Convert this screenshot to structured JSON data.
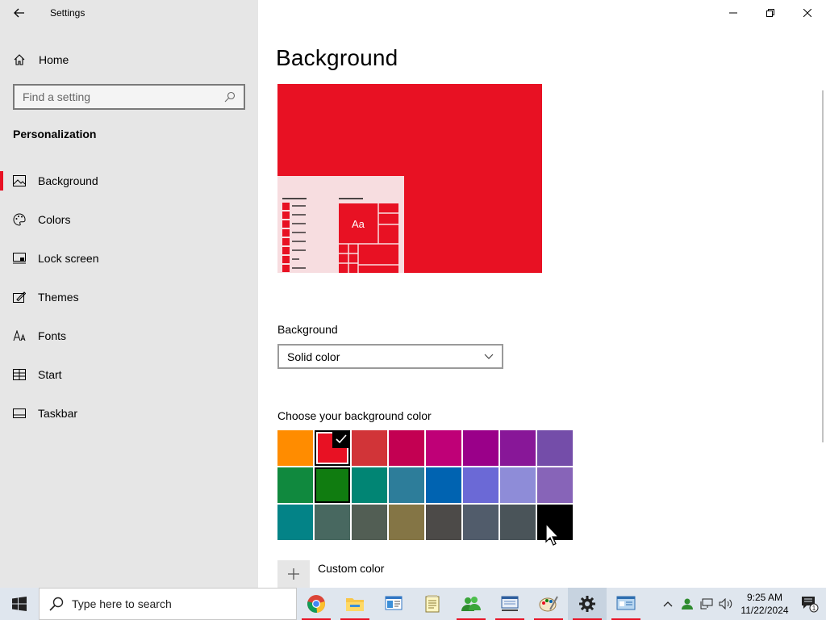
{
  "window": {
    "title": "Settings"
  },
  "sidebar": {
    "home_label": "Home",
    "search_placeholder": "Find a setting",
    "section_heading": "Personalization",
    "items": [
      {
        "label": "Background",
        "icon": "picture-icon",
        "active": true
      },
      {
        "label": "Colors",
        "icon": "palette-icon",
        "active": false
      },
      {
        "label": "Lock screen",
        "icon": "lock-screen-icon",
        "active": false
      },
      {
        "label": "Themes",
        "icon": "themes-icon",
        "active": false
      },
      {
        "label": "Fonts",
        "icon": "fonts-icon",
        "active": false
      },
      {
        "label": "Start",
        "icon": "start-icon",
        "active": false
      },
      {
        "label": "Taskbar",
        "icon": "taskbar-icon",
        "active": false
      }
    ]
  },
  "main": {
    "title": "Background",
    "preview": {
      "background_color": "#e81123",
      "tile_text": "Aa"
    },
    "background_dropdown": {
      "label": "Background",
      "value": "Solid color"
    },
    "color_picker": {
      "label": "Choose your background color",
      "selected_index": 1,
      "hovered_index": 9,
      "colors": [
        "#ff8c00",
        "#e81123",
        "#d13438",
        "#c30052",
        "#bf0077",
        "#9a0089",
        "#881798",
        "#744da9",
        "#10893e",
        "#107c10",
        "#018574",
        "#2d7d9a",
        "#0063b1",
        "#6b69d6",
        "#8e8cd8",
        "#8764b8",
        "#038387",
        "#486860",
        "#525e54",
        "#847545",
        "#4c4a48",
        "#515c6b",
        "#4a5459",
        "#000000"
      ]
    },
    "custom_color_label": "Custom color"
  },
  "taskbar": {
    "search_placeholder": "Type here to search",
    "apps": [
      {
        "name": "chrome-icon",
        "active": false,
        "running": true
      },
      {
        "name": "file-explorer-icon",
        "active": false,
        "running": true
      },
      {
        "name": "control-panel-icon",
        "active": false,
        "running": false
      },
      {
        "name": "notepad-icon",
        "active": false,
        "running": false
      },
      {
        "name": "users-icon",
        "active": false,
        "running": true
      },
      {
        "name": "network-window-icon",
        "active": false,
        "running": true
      },
      {
        "name": "paint-icon",
        "active": false,
        "running": true
      },
      {
        "name": "settings-gear-icon",
        "active": true,
        "running": true
      },
      {
        "name": "system-window-icon",
        "active": false,
        "running": true
      }
    ],
    "clock": {
      "time": "9:25 AM",
      "date": "11/22/2024"
    },
    "notification_count": "1"
  },
  "colors": {
    "accent": "#e81123",
    "sidebar_bg": "#e6e6e6",
    "taskbar_bg": "#dfe6ee"
  }
}
